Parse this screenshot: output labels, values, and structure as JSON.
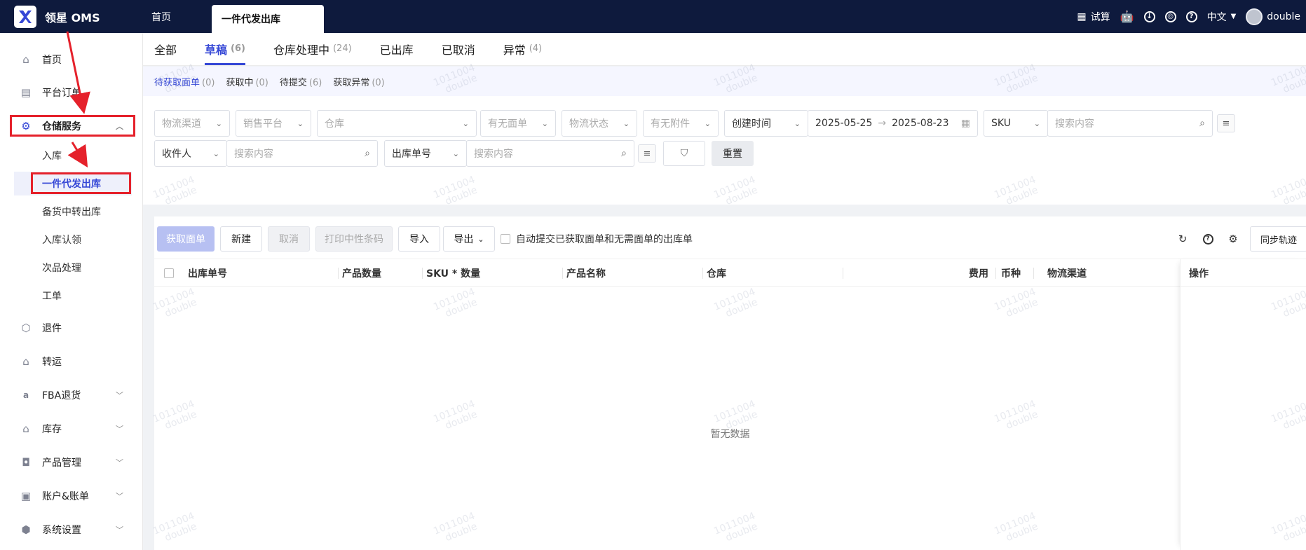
{
  "app": {
    "name": "领星 OMS",
    "top_tabs": [
      {
        "label": "首页"
      },
      {
        "label": "一件代发出库"
      }
    ],
    "top_right": {
      "trial": "试算",
      "language": "中文",
      "user": "double"
    }
  },
  "sidebar": {
    "items": [
      {
        "label": "首页",
        "icon": "home-icon"
      },
      {
        "label": "平台订单",
        "icon": "clipboard-icon"
      },
      {
        "label": "仓储服务",
        "icon": "warehouse-service-icon",
        "expanded": true
      },
      {
        "label": "退件",
        "icon": "return-box-icon"
      },
      {
        "label": "转运",
        "icon": "transfer-icon"
      },
      {
        "label": "FBA退货",
        "icon": "amazon-icon"
      },
      {
        "label": "库存",
        "icon": "inventory-icon"
      },
      {
        "label": "产品管理",
        "icon": "product-bag-icon"
      },
      {
        "label": "账户&账单",
        "icon": "account-icon"
      },
      {
        "label": "系统设置",
        "icon": "settings-hex-icon"
      }
    ],
    "sub_items": [
      {
        "label": "入库"
      },
      {
        "label": "一件代发出库",
        "active": true
      },
      {
        "label": "备货中转出库"
      },
      {
        "label": "入库认领"
      },
      {
        "label": "次品处理"
      },
      {
        "label": "工单"
      }
    ]
  },
  "status_tabs": [
    {
      "label": "全部",
      "count": ""
    },
    {
      "label": "草稿",
      "count": "(6)"
    },
    {
      "label": "仓库处理中",
      "count": "(24)"
    },
    {
      "label": "已出库",
      "count": ""
    },
    {
      "label": "已取消",
      "count": ""
    },
    {
      "label": "异常",
      "count": "(4)"
    }
  ],
  "sub_status": [
    {
      "label": "待获取面单",
      "count": "(0)"
    },
    {
      "label": "获取中",
      "count": "(0)"
    },
    {
      "label": "待提交",
      "count": "(6)"
    },
    {
      "label": "获取异常",
      "count": "(0)"
    }
  ],
  "filters": {
    "logistics_channel": "物流渠道",
    "sales_platform": "销售平台",
    "warehouse": "仓库",
    "has_label": "有无面单",
    "logistics_status": "物流状态",
    "has_attachment": "有无附件",
    "date_type": "创建时间",
    "date_start": "2025-05-25",
    "date_end": "2025-08-23",
    "sku_type": "SKU",
    "sku_placeholder": "搜索内容",
    "receiver_type": "收件人",
    "receiver_placeholder": "搜索内容",
    "order_type": "出库单号",
    "order_placeholder": "搜索内容",
    "reset": "重置"
  },
  "toolbar": {
    "get_label": "获取面单",
    "new": "新建",
    "cancel": "取消",
    "print_barcode": "打印中性条码",
    "import": "导入",
    "export": "导出",
    "auto_submit": "自动提交已获取面单和无需面单的出库单",
    "sync_track": "同步轨迹"
  },
  "table": {
    "columns": [
      "出库单号",
      "产品数量",
      "SKU * 数量",
      "产品名称",
      "仓库",
      "费用",
      "币种",
      "物流渠道",
      "操作"
    ],
    "empty_text": "暂无数据"
  },
  "watermark": {
    "line1": "1011004",
    "line2": "double"
  },
  "colors": {
    "topbar": "#0e1a3d",
    "accent": "#3547d6",
    "annotation_red": "#e5212b"
  }
}
